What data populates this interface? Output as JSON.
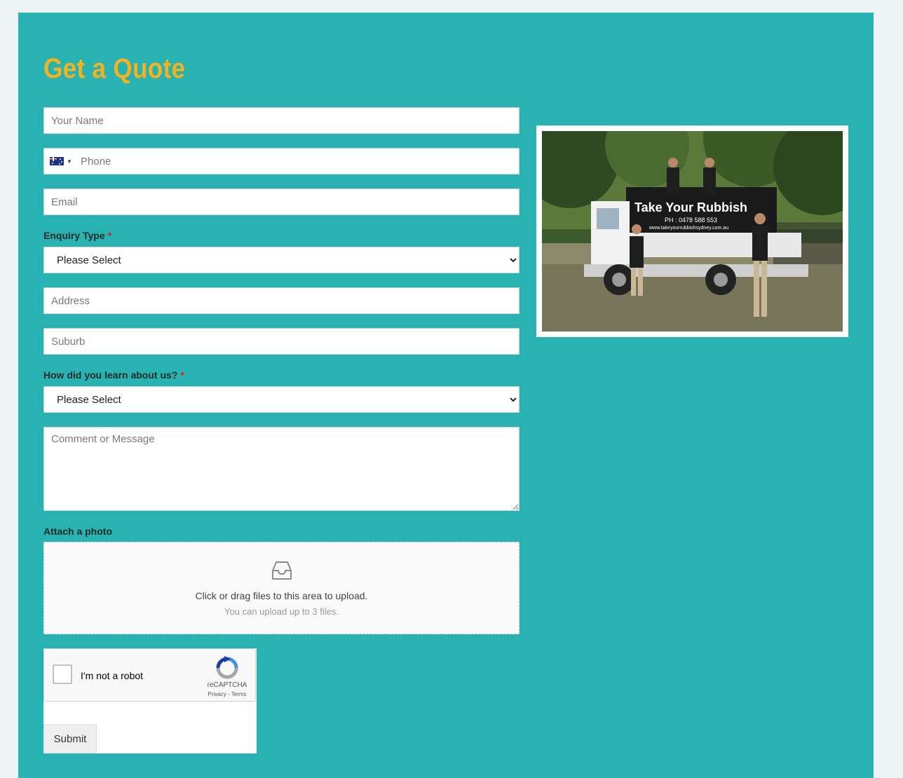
{
  "form": {
    "title": "Get a Quote",
    "name_placeholder": "Your Name",
    "phone_placeholder": "Phone",
    "phone_country": "AU",
    "email_placeholder": "Email",
    "enquiry_label": "Enquiry Type",
    "enquiry_required": "*",
    "enquiry_value": "Please Select",
    "address_placeholder": "Address",
    "suburb_placeholder": "Suburb",
    "learn_label": "How did you learn about us?",
    "learn_required": "*",
    "learn_value": "Please Select",
    "comment_placeholder": "Comment or Message",
    "attach_label": "Attach a photo",
    "upload_main": "Click or drag files to this area to upload.",
    "upload_sub": "You can upload up to 3 files.",
    "submit_label": "Submit"
  },
  "recaptcha": {
    "checkbox_label": "I'm not a robot",
    "brand": "reCAPTCHA",
    "links": "Privacy - Terms"
  },
  "photo": {
    "truck_sign": "Take Your Rubbish",
    "truck_phone": "PH : 0478 588 553",
    "truck_website": "www.takeyourrubbishsydney.com.au"
  },
  "colors": {
    "panel": "#28b2b2",
    "title": "#f3b21f",
    "required": "#e02020"
  }
}
